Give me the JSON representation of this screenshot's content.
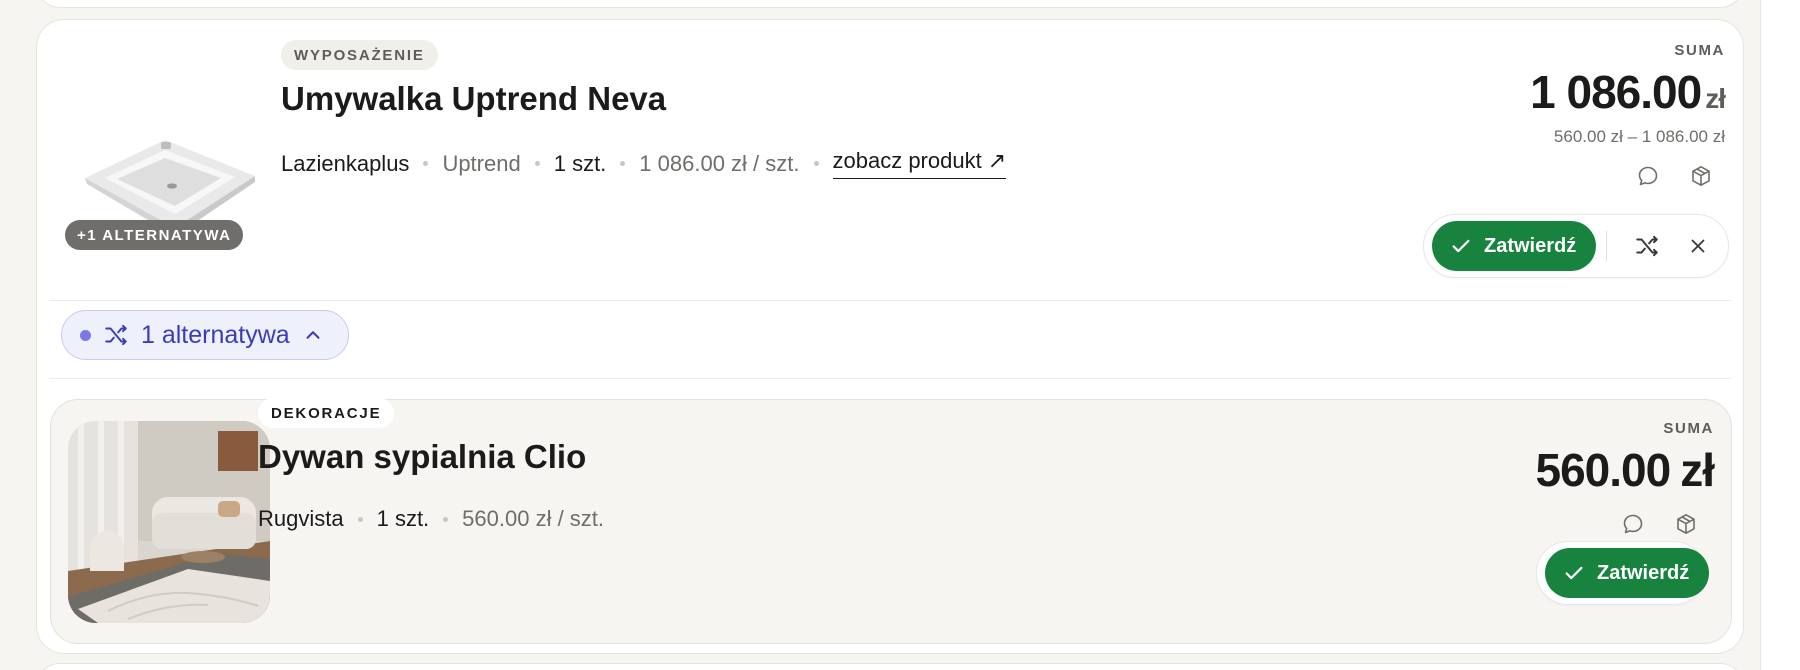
{
  "primary": {
    "category": "WYPOSAŻENIE",
    "title": "Umywalka Uptrend Neva",
    "alternatives_chip": "+1 ALTERNATYWA",
    "store": "Lazienkaplus",
    "brand": "Uptrend",
    "quantity": "1 szt.",
    "unit_price": "1 086.00 zł / szt.",
    "product_link": "zobacz produkt ↗",
    "sum_label": "SUMA",
    "sum_value": "1 086.00",
    "sum_currency": "zł",
    "price_range": "560.00 zł – 1 086.00 zł",
    "confirm_label": "Zatwierdź"
  },
  "alternatives_toggle": {
    "label": "1 alternatywa"
  },
  "alternative": {
    "category": "DEKORACJE",
    "title": "Dywan sypialnia Clio",
    "store": "Rugvista",
    "quantity": "1 szt.",
    "unit_price": "560.00 zł / szt.",
    "sum_label": "SUMA",
    "sum_value": "560.00",
    "sum_currency": "zł",
    "confirm_label": "Zatwierdź"
  },
  "icons": {
    "comment": "speech-bubble",
    "package": "box-3d",
    "check": "checkmark",
    "shuffle": "shuffle-arrows",
    "close": "x-mark",
    "chevron": "chevron-up"
  },
  "colors": {
    "confirm_green": "#17833f",
    "alt_accent": "#3d3bb8",
    "alt_dot": "#7b78e8"
  }
}
